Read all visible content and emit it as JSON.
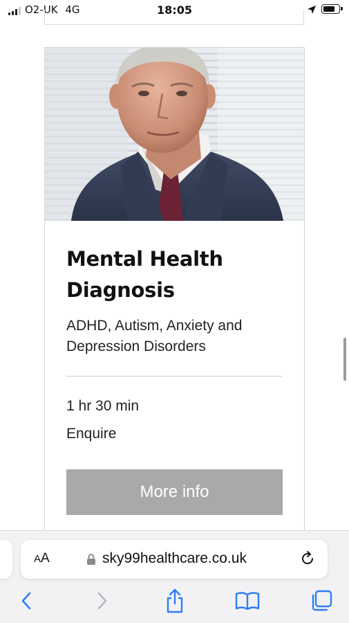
{
  "status_bar": {
    "carrier": "O2-UK",
    "network": "4G",
    "time": "18:05",
    "signal_bars_filled": 3,
    "signal_bars_total": 4,
    "battery_level_percent": 80
  },
  "card": {
    "image_description": "portrait of an older man in a suit and tie",
    "title_line1": "Mental Health",
    "title_line2": "Diagnosis",
    "subtitle_line1": "ADHD, Autism, Anxiety and",
    "subtitle_line2": "Depression Disorders",
    "duration": "1 hr 30 min",
    "price": "Enquire",
    "button_label": "More info"
  },
  "browser": {
    "reader_label_small": "A",
    "reader_label_large": "A",
    "url": "sky99healthcare.co.uk"
  },
  "colors": {
    "button_bg": "#a9a9a9",
    "button_text": "#ffffff",
    "safari_accent": "#2f7cf6",
    "title_text": "#111111"
  },
  "icons": [
    "signal-icon",
    "location-arrow-icon",
    "battery-icon",
    "lock-icon",
    "reload-icon",
    "back-icon",
    "forward-icon",
    "share-icon",
    "bookmarks-icon",
    "tabs-icon"
  ]
}
